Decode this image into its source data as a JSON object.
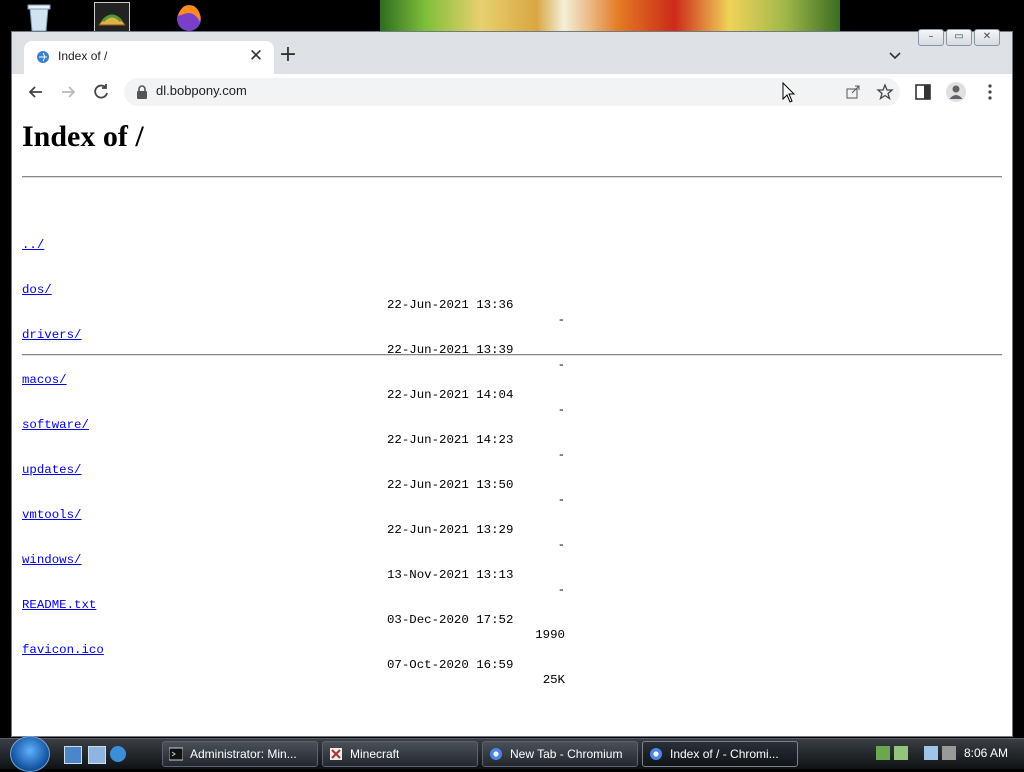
{
  "browser": {
    "tab_title": "Index of /",
    "url": "dl.bobpony.com",
    "new_tab_symbol": "+",
    "tab_close_symbol": "✕"
  },
  "page": {
    "heading": "Index of /",
    "entries": [
      {
        "name": "../",
        "date": "",
        "size": ""
      },
      {
        "name": "dos/",
        "date": "22-Jun-2021 13:36",
        "size": "-"
      },
      {
        "name": "drivers/",
        "date": "22-Jun-2021 13:39",
        "size": "-"
      },
      {
        "name": "macos/",
        "date": "22-Jun-2021 14:04",
        "size": "-"
      },
      {
        "name": "software/",
        "date": "22-Jun-2021 14:23",
        "size": "-"
      },
      {
        "name": "updates/",
        "date": "22-Jun-2021 13:50",
        "size": "-"
      },
      {
        "name": "vmtools/",
        "date": "22-Jun-2021 13:29",
        "size": "-"
      },
      {
        "name": "windows/",
        "date": "13-Nov-2021 13:13",
        "size": "-"
      },
      {
        "name": "README.txt",
        "date": "03-Dec-2020 17:52",
        "size": "1990"
      },
      {
        "name": "favicon.ico",
        "date": "07-Oct-2020 16:59",
        "size": "25K"
      }
    ]
  },
  "taskbar": {
    "buttons": [
      {
        "label": "Administrator:  Min...",
        "icon": "console-icon"
      },
      {
        "label": "Minecraft",
        "icon": "minecraft-icon"
      },
      {
        "label": "New Tab - Chromium",
        "icon": "chromium-icon"
      },
      {
        "label": "Index of / - Chromi...",
        "icon": "chromium-icon",
        "active": true
      }
    ],
    "clock": "8:06 AM"
  },
  "colors": {
    "link": "#0000ee",
    "tabstrip": "#dee1e6",
    "omnibox": "#f1f3f4"
  }
}
